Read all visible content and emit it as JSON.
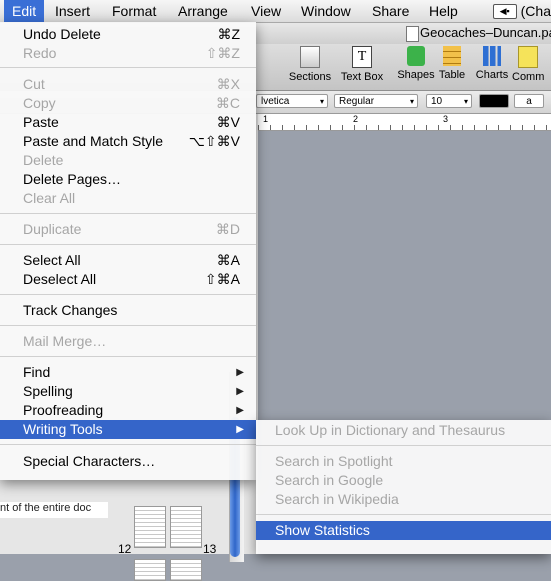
{
  "menubar": {
    "items": [
      "Edit",
      "Insert",
      "Format",
      "Arrange",
      "View",
      "Window",
      "Share",
      "Help"
    ],
    "right_text": "(Cha"
  },
  "window": {
    "doc_title": "Geocaches–Duncan.pa",
    "toolbar": [
      "Sections",
      "Text Box",
      "Shapes",
      "Table",
      "Charts",
      "Comm"
    ],
    "format": {
      "font": "lvetica",
      "style": "Regular",
      "size": "10",
      "text_button": "a"
    },
    "ruler_numbers": [
      "1",
      "2",
      "3"
    ],
    "page_numbers": [
      "12",
      "13"
    ],
    "doc_snippet": "nt of the entire doc"
  },
  "edit_menu": {
    "items": [
      {
        "label": "Undo Delete",
        "shortcut": "⌘Z",
        "disabled": false
      },
      {
        "label": "Redo",
        "shortcut": "⇧⌘Z",
        "disabled": true
      },
      {
        "label": "Cut",
        "shortcut": "⌘X",
        "disabled": true
      },
      {
        "label": "Copy",
        "shortcut": "⌘C",
        "disabled": true
      },
      {
        "label": "Paste",
        "shortcut": "⌘V",
        "disabled": false
      },
      {
        "label": "Paste and Match Style",
        "shortcut": "⌥⇧⌘V",
        "disabled": false
      },
      {
        "label": "Delete",
        "shortcut": "",
        "disabled": true
      },
      {
        "label": "Delete Pages…",
        "shortcut": "",
        "disabled": false
      },
      {
        "label": "Clear All",
        "shortcut": "",
        "disabled": true
      },
      {
        "label": "Duplicate",
        "shortcut": "⌘D",
        "disabled": true
      },
      {
        "label": "Select All",
        "shortcut": "⌘A",
        "disabled": false
      },
      {
        "label": "Deselect All",
        "shortcut": "⇧⌘A",
        "disabled": false
      },
      {
        "label": "Track Changes",
        "shortcut": "",
        "disabled": false
      },
      {
        "label": "Mail Merge…",
        "shortcut": "",
        "disabled": true
      },
      {
        "label": "Find",
        "shortcut": "",
        "disabled": false
      },
      {
        "label": "Spelling",
        "shortcut": "",
        "disabled": false
      },
      {
        "label": "Proofreading",
        "shortcut": "",
        "disabled": false
      },
      {
        "label": "Writing Tools",
        "shortcut": "",
        "disabled": false
      },
      {
        "label": "Special Characters…",
        "shortcut": "",
        "disabled": false
      }
    ]
  },
  "writing_tools_menu": {
    "items": [
      {
        "label": "Look Up in Dictionary and Thesaurus",
        "disabled": true
      },
      {
        "label": "Search in Spotlight",
        "disabled": true
      },
      {
        "label": "Search in Google",
        "disabled": true
      },
      {
        "label": "Search in Wikipedia",
        "disabled": true
      },
      {
        "label": "Show Statistics",
        "disabled": false
      }
    ]
  },
  "colors": {
    "highlight": "#3565c9",
    "disabled_text": "#a6a6a6"
  }
}
